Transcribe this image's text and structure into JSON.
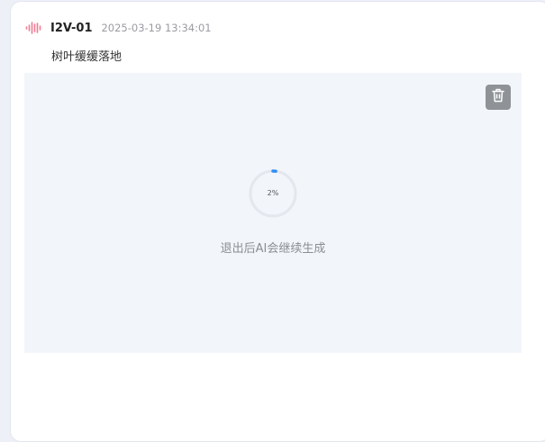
{
  "record": {
    "model_name": "I2V-01",
    "timestamp": "2025-03-19 13:34:01",
    "prompt": "树叶缓缓落地",
    "model_icon": "waveform-icon"
  },
  "preview": {
    "progress_label": "2%",
    "progress_value": 0.02,
    "status_message": "退出后AI会继续生成",
    "delete_icon": "trash-icon"
  },
  "colors": {
    "accent": "#2f8df5",
    "ring_track": "#e3e7ee",
    "preview_bg": "#f2f5f9",
    "delete_bg": "#8f9297",
    "model_icon": "#f07a93"
  }
}
